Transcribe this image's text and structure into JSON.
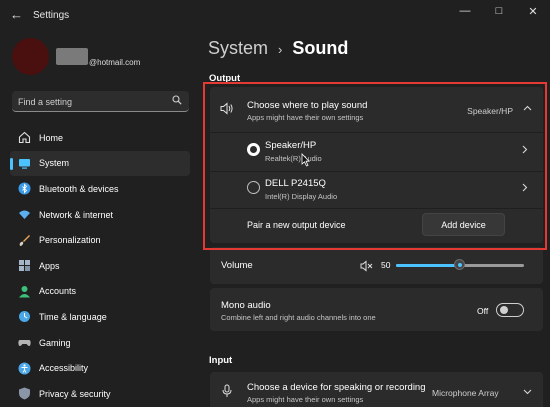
{
  "window": {
    "title": "Settings",
    "minimize": "—",
    "maximize": "□",
    "close": "✕"
  },
  "user": {
    "email": "@hotmail.com"
  },
  "search": {
    "placeholder": "Find a setting"
  },
  "sidebar": {
    "items": [
      {
        "label": "Home",
        "icon": "home-icon",
        "color": "#e0e0e0"
      },
      {
        "label": "System",
        "icon": "system-icon",
        "color": "#4cc2ff",
        "active": true
      },
      {
        "label": "Bluetooth & devices",
        "icon": "bluetooth-icon",
        "color": "#3a9ae8"
      },
      {
        "label": "Network & internet",
        "icon": "network-icon",
        "color": "#5bb0f0"
      },
      {
        "label": "Personalization",
        "icon": "brush-icon",
        "color": "#e8a25a"
      },
      {
        "label": "Apps",
        "icon": "apps-icon",
        "color": "#a6b6c8"
      },
      {
        "label": "Accounts",
        "icon": "accounts-icon",
        "color": "#3cc07a"
      },
      {
        "label": "Time & language",
        "icon": "globe-clock-icon",
        "color": "#4aa8e8"
      },
      {
        "label": "Gaming",
        "icon": "gaming-icon",
        "color": "#b4b4b4"
      },
      {
        "label": "Accessibility",
        "icon": "accessibility-icon",
        "color": "#4aa8e8"
      },
      {
        "label": "Privacy & security",
        "icon": "shield-icon",
        "color": "#8a96a8"
      }
    ]
  },
  "breadcrumb": {
    "parent": "System",
    "separator": "›",
    "current": "Sound"
  },
  "output": {
    "section_title": "Output",
    "header": {
      "title": "Choose where to play sound",
      "subtitle": "Apps might have their own settings",
      "value": "Speaker/HP"
    },
    "devices": [
      {
        "name": "Speaker/HP",
        "driver": "Realtek(R) Audio",
        "selected": true
      },
      {
        "name": "DELL P2415Q",
        "driver": "Intel(R) Display Audio",
        "selected": false
      }
    ],
    "pair": {
      "label": "Pair a new output device",
      "button": "Add device"
    },
    "volume": {
      "label": "Volume",
      "value": "50",
      "level": 0.5
    },
    "mono": {
      "title": "Mono audio",
      "subtitle": "Combine left and right audio channels into one",
      "state": "Off"
    }
  },
  "input": {
    "section_title": "Input",
    "header": {
      "title": "Choose a device for speaking or recording",
      "subtitle": "Apps might have their own settings",
      "value": "Microphone Array"
    }
  },
  "colors": {
    "accent": "#4cc2ff",
    "highlight": "#e53935",
    "background": "#202020",
    "card": "#2b2b2b"
  }
}
